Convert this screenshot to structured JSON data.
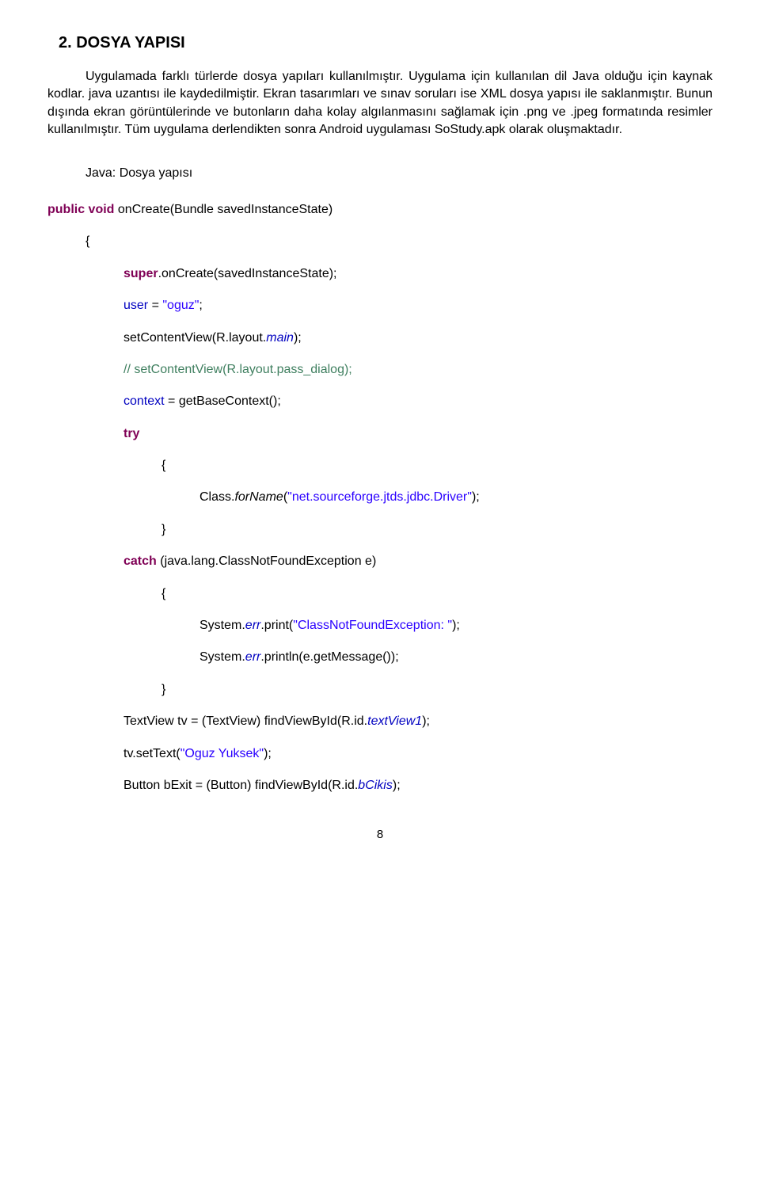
{
  "heading": "2. DOSYA YAPISI",
  "paragraph": "Uygulamada farklı türlerde dosya yapıları kullanılmıştır. Uygulama için kullanılan dil Java olduğu için kaynak kodlar. java uzantısı ile kaydedilmiştir. Ekran tasarımları ve sınav soruları ise XML dosya yapısı ile saklanmıştır. Bunun dışında ekran görüntülerinde ve butonların daha kolay algılanmasını sağlamak için .png ve .jpeg formatında resimler kullanılmıştır. Tüm uygulama derlendikten sonra Android uygulaması SoStudy.apk olarak oluşmaktadır.",
  "java_title": "Java: Dosya yapısı",
  "code": {
    "l1a": "public void",
    "l1b": " onCreate(Bundle savedInstanceState)",
    "l2": "{",
    "l3a": "super",
    "l3b": ".onCreate(savedInstanceState);",
    "l4a": "user",
    "l4b": " = ",
    "l4c": "\"oguz\"",
    "l4d": ";",
    "l5a": " setContentView(R.layout.",
    "l5b": "main",
    "l5c": ");",
    "l6": "// setContentView(R.layout.pass_dialog);",
    "l7a": "context",
    "l7b": " = getBaseContext();",
    "l8": "try",
    "l9": "{",
    "l10a": "Class.",
    "l10b": "forName",
    "l10c": "(",
    "l10d": "\"net.sourceforge.jtds.jdbc.Driver\"",
    "l10e": ");",
    "l11": "}",
    "l12a": "catch",
    "l12b": " (java.lang.ClassNotFoundException e)",
    "l13": "{",
    "l14a": "System.",
    "l14b": "err",
    "l14c": ".print(",
    "l14d": "\"ClassNotFoundException: \"",
    "l14e": ");",
    "l15a": "System.",
    "l15b": "err",
    "l15c": ".println(e.getMessage());",
    "l16": "}",
    "l17a": "TextView tv = (TextView) findViewById(R.id.",
    "l17b": "textView1",
    "l17c": ");",
    "l18a": "tv.setText(",
    "l18b": "\"Oguz Yuksek\"",
    "l18c": ");",
    "l19a": "Button bExit = (Button) findViewById(R.id.",
    "l19b": "bCikis",
    "l19c": ");"
  },
  "page_number": "8"
}
